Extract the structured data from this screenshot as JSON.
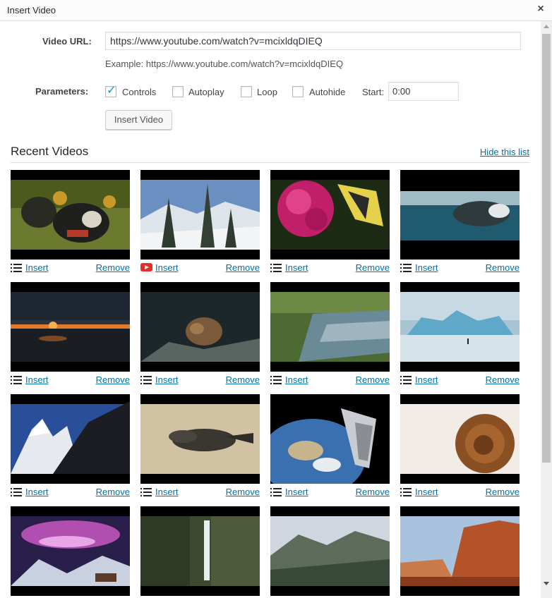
{
  "window": {
    "title": "Insert Video",
    "close_label": "×"
  },
  "form": {
    "video_url_label": "Video URL:",
    "video_url_value": "https://www.youtube.com/watch?v=mcixldqDIEQ",
    "example_text": "Example: https://www.youtube.com/watch?v=mcixldqDIEQ",
    "parameters_label": "Parameters:",
    "options": [
      {
        "label": "Controls",
        "checked": true
      },
      {
        "label": "Autoplay",
        "checked": false
      },
      {
        "label": "Loop",
        "checked": false
      },
      {
        "label": "Autohide",
        "checked": false
      }
    ],
    "start_label": "Start:",
    "start_value": "0:00",
    "insert_button": "Insert Video"
  },
  "recent": {
    "heading": "Recent Videos",
    "hide_link": "Hide this list",
    "insert_label": "Insert",
    "remove_label": "Remove",
    "videos": [
      {
        "scene": "crowned-cranes",
        "icon": "list-icon"
      },
      {
        "scene": "snowy-mountains",
        "icon": "youtube-icon"
      },
      {
        "scene": "flower-butterfly",
        "icon": "list-icon"
      },
      {
        "scene": "underwater-seal",
        "icon": "list-icon"
      },
      {
        "scene": "sunset-sea",
        "icon": "list-icon"
      },
      {
        "scene": "dark-creature",
        "icon": "list-icon"
      },
      {
        "scene": "river-grass",
        "icon": "list-icon"
      },
      {
        "scene": "iceberg",
        "icon": "list-icon"
      },
      {
        "scene": "alpine-peaks",
        "icon": "list-icon"
      },
      {
        "scene": "sand-crocodiles",
        "icon": "list-icon"
      },
      {
        "scene": "earth-from-space",
        "icon": "list-icon"
      },
      {
        "scene": "snail-shell",
        "icon": "list-icon"
      },
      {
        "scene": "aurora-village",
        "icon": "list-icon"
      },
      {
        "scene": "waterfall-cliff",
        "icon": "list-icon"
      },
      {
        "scene": "valley-landscape",
        "icon": "list-icon"
      },
      {
        "scene": "red-canyon",
        "icon": "list-icon"
      }
    ]
  },
  "colors": {
    "link": "#0073aa",
    "checkmark": "#1e8cbe",
    "youtube": "#e52d27"
  }
}
